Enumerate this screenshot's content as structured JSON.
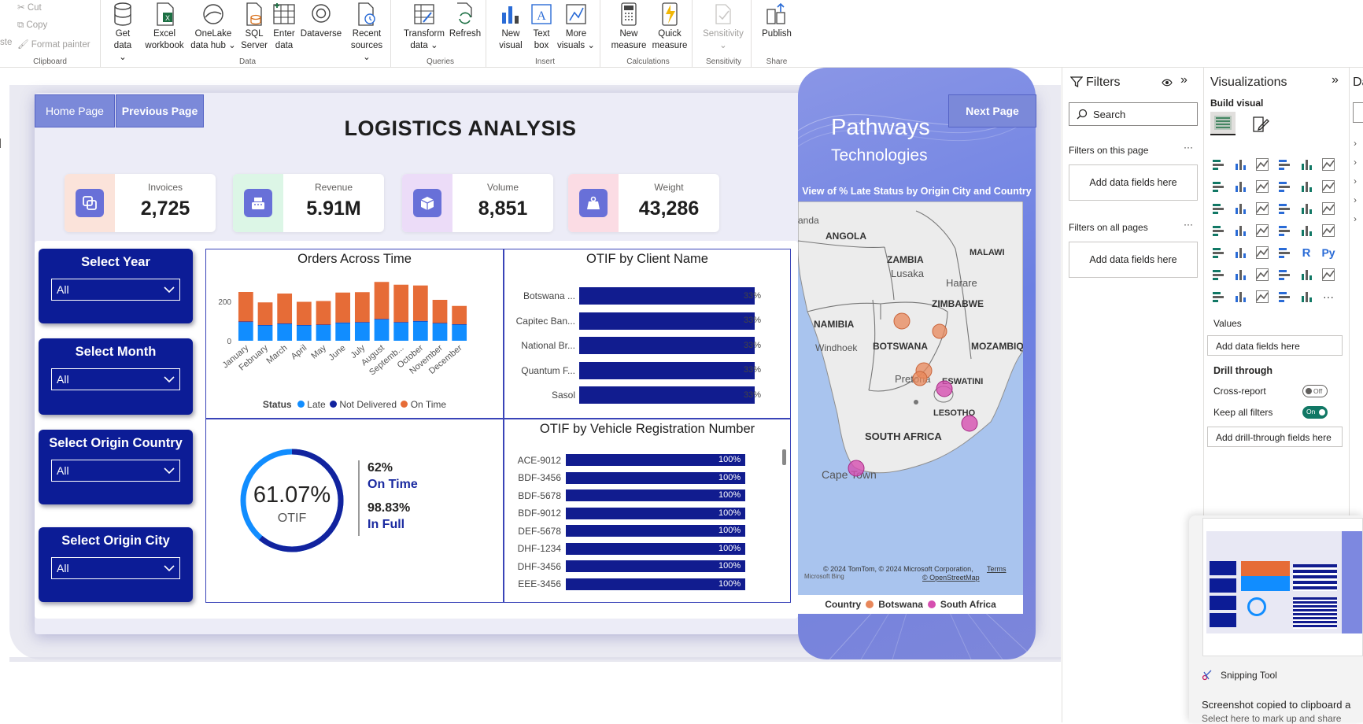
{
  "ribbon": {
    "clipboard": {
      "cut": "Cut",
      "copy": "Copy",
      "format_painter": "Format painter",
      "paste_partial": "ste",
      "group": "Clipboard"
    },
    "data_group": "Data",
    "queries_group": "Queries",
    "insert_group": "Insert",
    "calculations_group": "Calculations",
    "sensitivity_group": "Sensitivity",
    "share_group": "Share",
    "buttons": {
      "get_data": "Get\ndata ⌄",
      "excel": "Excel\nworkbook",
      "onelake": "OneLake\ndata hub ⌄",
      "sql": "SQL\nServer",
      "enter": "Enter\ndata",
      "dataverse": "Dataverse",
      "recent": "Recent\nsources ⌄",
      "transform": "Transform\ndata ⌄",
      "refresh": "Refresh",
      "new_visual": "New\nvisual",
      "text_box": "Text\nbox",
      "more_visuals": "More\nvisuals ⌄",
      "new_measure": "New\nmeasure",
      "quick_measure": "Quick\nmeasure",
      "sensitivity": "Sensitivity\n⌄",
      "publish": "Publish"
    }
  },
  "report": {
    "nav": {
      "home": "Home Page",
      "previous": "Previous Page",
      "next": "Next Page"
    },
    "title": "LOGISTICS ANALYSIS",
    "kpis": [
      {
        "label": "Invoices",
        "value": "2,725",
        "bg": "#fbe3da"
      },
      {
        "label": "Revenue",
        "value": "5.91M",
        "bg": "#dcf6e6"
      },
      {
        "label": "Volume",
        "value": "8,851",
        "bg": "#ecdcf8"
      },
      {
        "label": "Weight",
        "value": "43,286",
        "bg": "#fbdce4"
      }
    ],
    "slicers": [
      {
        "title": "Select Year",
        "value": "All"
      },
      {
        "title": "Select Month",
        "value": "All"
      },
      {
        "title": "Select Origin Country",
        "value": "All"
      },
      {
        "title": "Select Origin City",
        "value": "All"
      }
    ],
    "brand": {
      "line1": "Pathways",
      "line2": "Technologies"
    },
    "map": {
      "title": "View of % Late Status by Origin City and Country",
      "labels": [
        "anda",
        "ANGOLA",
        "ZAMBIA",
        "Lusaka",
        "MALAWI",
        "Harare",
        "ZIMBABWE",
        "NAMIBIA",
        "Windhoek",
        "BOTSWANA",
        "MOZAMBIQU",
        "Pretoria",
        "ESWATINI",
        "LESOTHO",
        "SOUTH AFRICA",
        "Cape Town"
      ],
      "copyright": "© 2024 TomTom, © 2024 Microsoft Corporation,",
      "terms": "Terms",
      "osm": "© OpenStreetMap",
      "bing": "Microsoft Bing",
      "legend_title": "Country",
      "legend": [
        {
          "name": "Botswana",
          "color": "#e8875a"
        },
        {
          "name": "South Africa",
          "color": "#d64fb0"
        }
      ]
    },
    "otif": {
      "value": "61.07%",
      "label": "OTIF",
      "ontime_pct": "62%",
      "ontime_label": "On Time",
      "infull_pct": "98.83%",
      "infull_label": "In Full",
      "fraction": 0.6107
    }
  },
  "chart_data": [
    {
      "type": "bar",
      "title": "Orders Across Time",
      "stacked": true,
      "categories": [
        "January",
        "February",
        "March",
        "April",
        "May",
        "June",
        "July",
        "August",
        "Septemb...",
        "October",
        "November",
        "December"
      ],
      "series": [
        {
          "name": "Late",
          "color": "#118dff",
          "values": [
            95,
            78,
            85,
            78,
            80,
            90,
            92,
            108,
            92,
            98,
            88,
            82
          ]
        },
        {
          "name": "Not Delivered",
          "color": "#12239e",
          "values": [
            3,
            2,
            3,
            2,
            2,
            3,
            3,
            3,
            3,
            3,
            2,
            2
          ]
        },
        {
          "name": "On Time",
          "color": "#e66c37",
          "values": [
            150,
            115,
            152,
            118,
            120,
            152,
            152,
            188,
            190,
            180,
            118,
            93
          ]
        }
      ],
      "legend_title": "Status",
      "yticks": [
        0,
        200
      ],
      "ylim": [
        0,
        320
      ]
    },
    {
      "type": "bar",
      "orientation": "horizontal",
      "title": "OTIF by Client Name",
      "categories": [
        "Botswana ...",
        "Capitec Ban...",
        "National Br...",
        "Quantum F...",
        "Sasol"
      ],
      "values": [
        33,
        33,
        33,
        33,
        33
      ],
      "value_labels": [
        "33%",
        "33%",
        "33%",
        "33%",
        "33%"
      ],
      "xlim": [
        0,
        33
      ]
    },
    {
      "type": "bar",
      "orientation": "horizontal",
      "title": "OTIF by Vehicle Registration Number",
      "categories": [
        "ACE-9012",
        "BDF-3456",
        "BDF-5678",
        "BDF-9012",
        "DEF-5678",
        "DHF-1234",
        "DHF-3456",
        "EEE-3456"
      ],
      "values": [
        100,
        100,
        100,
        100,
        100,
        100,
        100,
        100
      ],
      "value_labels": [
        "100%",
        "100%",
        "100%",
        "100%",
        "100%",
        "100%",
        "100%",
        "100%"
      ],
      "xlim": [
        0,
        100
      ]
    }
  ],
  "filters": {
    "title": "Filters",
    "search": "Search",
    "on_page": "Filters on this page",
    "on_all": "Filters on all pages",
    "add": "Add data fields here"
  },
  "viz": {
    "title": "Visualizations",
    "build": "Build visual",
    "values": "Values",
    "add_data": "Add data fields here",
    "drill": "Drill through",
    "cross": "Cross-report",
    "cross_state": "Off",
    "keep": "Keep all filters",
    "keep_state": "On",
    "add_drill": "Add drill-through fields here",
    "more": "···",
    "r_icon": "R",
    "py_icon": "Py",
    "data_partial": "Da"
  },
  "snipping": {
    "app": "Snipping Tool",
    "msg1": "Screenshot copied to clipboard a",
    "msg2": "Select here to mark up and share"
  }
}
